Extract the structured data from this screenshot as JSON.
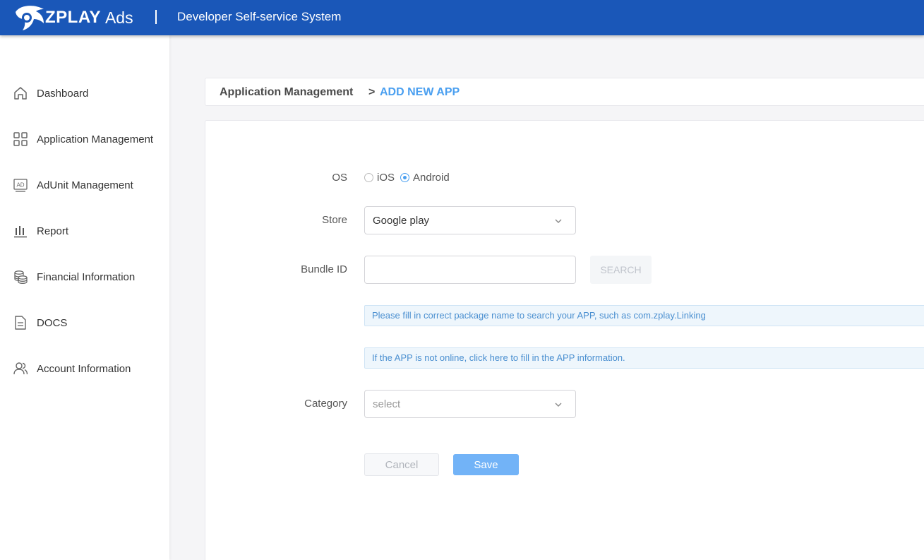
{
  "header": {
    "brand": "ZPLAY",
    "brand_suffix": "Ads",
    "title": "Developer Self-service System"
  },
  "sidebar": {
    "items": [
      {
        "label": "Dashboard",
        "icon": "home-icon"
      },
      {
        "label": "Application Management",
        "icon": "grid-icon"
      },
      {
        "label": "AdUnit Management",
        "icon": "ad-icon"
      },
      {
        "label": "Report",
        "icon": "bar-chart-icon"
      },
      {
        "label": "Financial Information",
        "icon": "coins-icon"
      },
      {
        "label": "DOCS",
        "icon": "document-icon"
      },
      {
        "label": "Account Information",
        "icon": "users-icon"
      }
    ]
  },
  "breadcrumb": {
    "parent": "Application Management",
    "separator": ">",
    "current": "ADD NEW APP"
  },
  "form": {
    "os_label": "OS",
    "os_options": [
      "iOS",
      "Android"
    ],
    "os_selected": "Android",
    "store_label": "Store",
    "store_value": "Google play",
    "bundle_label": "Bundle ID",
    "bundle_value": "",
    "search_label": "SEARCH",
    "tip_search": "Please fill in correct package name to search your APP, such as com.zplay.Linking",
    "tip_offline": "If the APP is not online, click here to fill in the APP information.",
    "category_label": "Category",
    "category_placeholder": "select",
    "cancel_label": "Cancel",
    "save_label": "Save"
  },
  "colors": {
    "header_bg": "#1a57b8",
    "accent": "#4a9ff0",
    "save_button": "#72b3f7"
  }
}
